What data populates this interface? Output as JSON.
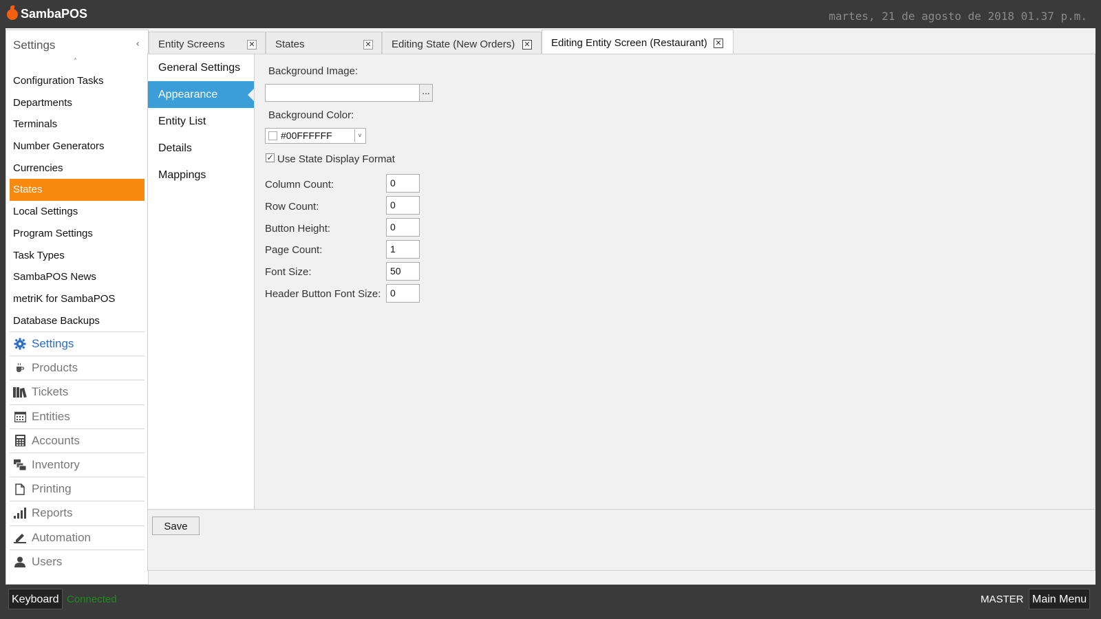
{
  "app": {
    "name": "SambaPOS",
    "datetime": "martes, 21 de agosto de 2018 01.37 p.m."
  },
  "left_panel": {
    "title": "Settings",
    "items": [
      "Configuration Tasks",
      "Departments",
      "Terminals",
      "Number Generators",
      "Currencies",
      "States",
      "Local Settings",
      "Program Settings",
      "Task Types",
      "SambaPOS News",
      "metriK for SambaPOS",
      "Database Backups"
    ],
    "selected": "States"
  },
  "nav": [
    {
      "label": "Settings",
      "icon": "gear-icon",
      "active": true
    },
    {
      "label": "Products",
      "icon": "coffee-cup-icon"
    },
    {
      "label": "Tickets",
      "icon": "books-icon"
    },
    {
      "label": "Entities",
      "icon": "calendar-grid-icon"
    },
    {
      "label": "Accounts",
      "icon": "calculator-icon"
    },
    {
      "label": "Inventory",
      "icon": "inventory-boxes-icon"
    },
    {
      "label": "Printing",
      "icon": "document-icon"
    },
    {
      "label": "Reports",
      "icon": "bar-chart-icon"
    },
    {
      "label": "Automation",
      "icon": "pencil-icon"
    },
    {
      "label": "Users",
      "icon": "user-icon"
    }
  ],
  "tabs": [
    {
      "label": "Entity Screens"
    },
    {
      "label": "States"
    },
    {
      "label": "Editing State (New Orders)"
    },
    {
      "label": "Editing Entity Screen (Restaurant)",
      "active": true
    }
  ],
  "subnav": {
    "items": [
      "General Settings",
      "Appearance",
      "Entity List",
      "Details",
      "Mappings"
    ],
    "selected": "Appearance"
  },
  "form": {
    "background_image_label": "Background Image:",
    "background_image_value": "",
    "browse_label": "...",
    "background_color_label": "Background Color:",
    "background_color_value": "#00FFFFFF",
    "use_state_display_format_label": "Use State Display Format",
    "use_state_display_format_checked": true,
    "column_count_label": "Column Count:",
    "column_count": "0",
    "row_count_label": "Row Count:",
    "row_count": "0",
    "button_height_label": "Button Height:",
    "button_height": "0",
    "page_count_label": "Page Count:",
    "page_count": "1",
    "font_size_label": "Font Size:",
    "font_size": "50",
    "header_button_font_size_label": "Header Button Font Size:",
    "header_button_font_size": "0"
  },
  "save_label": "Save",
  "statusbar": {
    "keyboard_label": "Keyboard",
    "connection_status": "Connected",
    "user": "MASTER",
    "main_menu_label": "Main Menu"
  }
}
